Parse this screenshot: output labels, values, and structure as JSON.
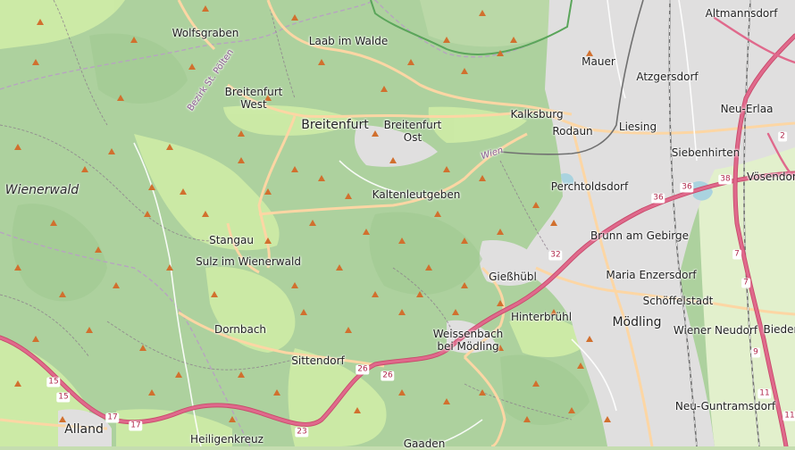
{
  "map": {
    "places": [
      {
        "id": "wolfsgraben",
        "label": "Wolfsgraben",
        "cls": "town"
      },
      {
        "id": "laab-im-walde",
        "label": "Laab im Walde",
        "cls": "town"
      },
      {
        "id": "altmannsdorf",
        "label": "Altmannsdorf",
        "cls": "town"
      },
      {
        "id": "mauer",
        "label": "Mauer",
        "cls": "town"
      },
      {
        "id": "atzgersdorf",
        "label": "Atzgersdorf",
        "cls": "town"
      },
      {
        "id": "breitenfurt-west",
        "label": "Breitenfurt\nWest",
        "cls": "town multi"
      },
      {
        "id": "breitenfurt",
        "label": "Breitenfurt",
        "cls": "big"
      },
      {
        "id": "breitenfurt-ost",
        "label": "Breitenfurt\nOst",
        "cls": "town multi"
      },
      {
        "id": "kalksburg",
        "label": "Kalksburg",
        "cls": "town"
      },
      {
        "id": "rodaun",
        "label": "Rodaun",
        "cls": "town"
      },
      {
        "id": "liesing",
        "label": "Liesing",
        "cls": "town"
      },
      {
        "id": "neu-erlaa",
        "label": "Neu-Erlaa",
        "cls": "town"
      },
      {
        "id": "siebenhirten",
        "label": "Siebenhirten",
        "cls": "town"
      },
      {
        "id": "vosendorf",
        "label": "Vösendorf",
        "cls": "town"
      },
      {
        "id": "perchtoldsdorf",
        "label": "Perchtoldsdorf",
        "cls": "town"
      },
      {
        "id": "kaltenleutgeben",
        "label": "Kaltenleutgeben",
        "cls": "town"
      },
      {
        "id": "wienerwald",
        "label": "Wienerwald",
        "cls": "region"
      },
      {
        "id": "stangau",
        "label": "Stangau",
        "cls": "town"
      },
      {
        "id": "sulz",
        "label": "Sulz im Wienerwald",
        "cls": "town"
      },
      {
        "id": "brunn",
        "label": "Brunn am Gebirge",
        "cls": "town"
      },
      {
        "id": "maria-enzersdorf",
        "label": "Maria Enzersdorf",
        "cls": "town"
      },
      {
        "id": "giesshubl",
        "label": "Gießhübl",
        "cls": "town"
      },
      {
        "id": "schoffelstadt",
        "label": "Schöffelstadt",
        "cls": "town"
      },
      {
        "id": "hinterbruhl",
        "label": "Hinterbrühl",
        "cls": "town"
      },
      {
        "id": "modling",
        "label": "Mödling",
        "cls": "big"
      },
      {
        "id": "dornbach",
        "label": "Dornbach",
        "cls": "town"
      },
      {
        "id": "wiener-neudorf",
        "label": "Wiener Neudorf",
        "cls": "town"
      },
      {
        "id": "bieder",
        "label": "Bieder",
        "cls": "town"
      },
      {
        "id": "weissenbach",
        "label": "Weissenbach\nbei Mödling",
        "cls": "town multi"
      },
      {
        "id": "sittendorf",
        "label": "Sittendorf",
        "cls": "town"
      },
      {
        "id": "neu-guntramsdorf",
        "label": "Neu-Guntramsdorf",
        "cls": "town"
      },
      {
        "id": "alland",
        "label": "Alland",
        "cls": "big"
      },
      {
        "id": "heiligenkreuz",
        "label": "Heiligenkreuz",
        "cls": "town"
      },
      {
        "id": "gaaden",
        "label": "Gaaden",
        "cls": "town"
      },
      {
        "id": "bezirk-st-polten",
        "label": "Bezirk St. Pölten",
        "cls": "admin"
      },
      {
        "id": "wien-road",
        "label": "Wien",
        "cls": "road"
      }
    ],
    "shields": [
      {
        "id": "a21-15a",
        "label": "15"
      },
      {
        "id": "a21-15b",
        "label": "15"
      },
      {
        "id": "a21-17a",
        "label": "17"
      },
      {
        "id": "a21-17b",
        "label": "17"
      },
      {
        "id": "a21-23",
        "label": "23"
      },
      {
        "id": "a21-26a",
        "label": "26"
      },
      {
        "id": "a21-26b",
        "label": "26"
      },
      {
        "id": "a21-32",
        "label": "32"
      },
      {
        "id": "a21-36a",
        "label": "36"
      },
      {
        "id": "a21-36b",
        "label": "36"
      },
      {
        "id": "a21-38",
        "label": "38"
      },
      {
        "id": "a2-2",
        "label": "2"
      },
      {
        "id": "a2-7a",
        "label": "7"
      },
      {
        "id": "a2-7b",
        "label": "7"
      },
      {
        "id": "a2-9",
        "label": "9"
      },
      {
        "id": "a2-11a",
        "label": "11"
      },
      {
        "id": "a2-11b",
        "label": "11"
      }
    ],
    "colors": {
      "forest": "#add19e",
      "forest_dark": "#9fc98f",
      "meadow": "#cfeca6",
      "urban": "#e0dfdf",
      "motorway": "#e0698c",
      "primary": "#fcd6a4",
      "rail": "#707070",
      "admin": "#b7a4c0",
      "peak": "#d1702e",
      "water": "#aad3df"
    }
  }
}
